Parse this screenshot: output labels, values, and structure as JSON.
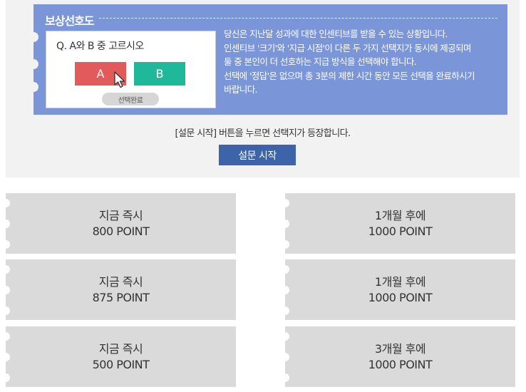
{
  "banner": {
    "title": "보상선호도",
    "sample": {
      "question": "Q. A와 B 중 고르시오",
      "option_a": "A",
      "option_b": "B",
      "done_label": "선택완료"
    },
    "description": [
      "당신은 지난달 성과에 대한 인센티브를 받을 수 있는 상황입니다.",
      "인센티브 '크기'와 '지급 시점'이 다른 두 가지 선택지가 동시에 제공되며",
      "둘 중 본인이 더 선호하는 지급 방식을 선택해야 합니다.",
      "선택에 '정답'은 없으며 총 3분의 제한 시간 동안 모든 선택을 완료하시기",
      "바랍니다."
    ]
  },
  "start_hint": "[설문 시작] 버튼을 누르면 선택지가 등장합니다.",
  "start_button": "설문 시작",
  "choices": [
    {
      "left": {
        "line1": "지금 즉시",
        "line2": "800 POINT"
      },
      "right": {
        "line1": "1개월 후에",
        "line2": "1000 POINT"
      }
    },
    {
      "left": {
        "line1": "지금 즉시",
        "line2": "875 POINT"
      },
      "right": {
        "line1": "1개월 후에",
        "line2": "1000 POINT"
      }
    },
    {
      "left": {
        "line1": "지금 즉시",
        "line2": "500 POINT"
      },
      "right": {
        "line1": "3개월 후에",
        "line2": "1000 POINT"
      }
    }
  ],
  "colors": {
    "banner": "#7b95d9",
    "option_a": "#e25a5a",
    "option_b": "#1fb89a",
    "start_button": "#3d64a8",
    "choice_card": "#dadada"
  },
  "icons": {
    "cursor": "mouse-pointer-icon"
  }
}
